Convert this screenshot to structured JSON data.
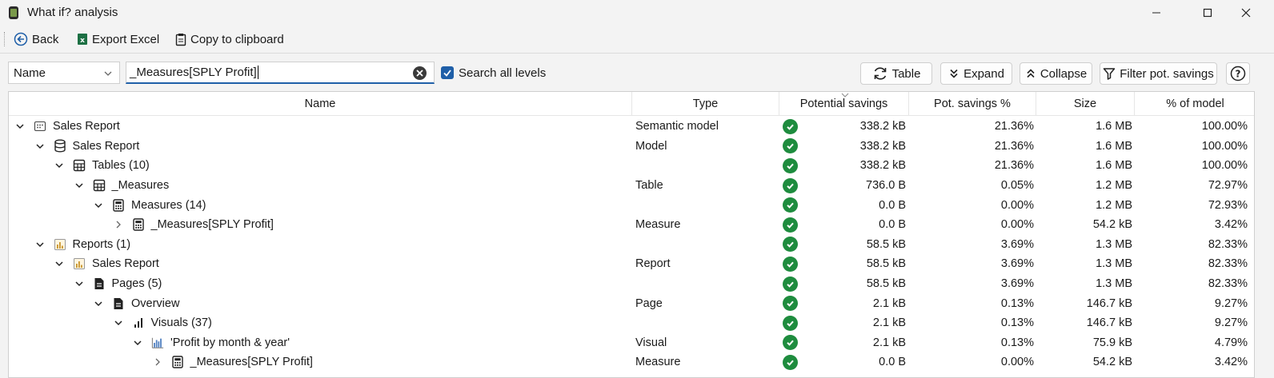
{
  "window": {
    "title": "What if? analysis"
  },
  "toolbar": {
    "back_label": "Back",
    "export_label": "Export Excel",
    "copy_label": "Copy to clipboard"
  },
  "filter": {
    "column_value": "Name",
    "search_value": "_Measures[SPLY Profit]",
    "search_all_levels_label": "Search all levels",
    "search_all_levels_checked": true
  },
  "buttons": {
    "table_label": "Table",
    "expand_label": "Expand",
    "collapse_label": "Collapse",
    "filter_label": "Filter pot. savings"
  },
  "columns": {
    "name": "Name",
    "type": "Type",
    "potential_savings": "Potential savings",
    "pot_savings_pct": "Pot. savings %",
    "size": "Size",
    "pct_of_model": "% of model"
  },
  "status_color": "#1e8c3e",
  "rows": [
    {
      "depth": 0,
      "expander": "open",
      "icon": "semantic-model-icon",
      "name": "Sales Report",
      "type": "Semantic model",
      "pot": "338.2 kB",
      "pct": "21.36%",
      "size": "1.6 MB",
      "model": "100.00%"
    },
    {
      "depth": 1,
      "expander": "open",
      "icon": "database-icon",
      "name": "Sales Report",
      "type": "Model",
      "pot": "338.2 kB",
      "pct": "21.36%",
      "size": "1.6 MB",
      "model": "100.00%"
    },
    {
      "depth": 2,
      "expander": "open",
      "icon": "table-grid-icon",
      "name": "Tables (10)",
      "type": "",
      "pot": "338.2 kB",
      "pct": "21.36%",
      "size": "1.6 MB",
      "model": "100.00%"
    },
    {
      "depth": 3,
      "expander": "open",
      "icon": "table-grid-icon",
      "name": "_Measures",
      "type": "Table",
      "pot": "736.0 B",
      "pct": "0.05%",
      "size": "1.2 MB",
      "model": "72.97%"
    },
    {
      "depth": 4,
      "expander": "open",
      "icon": "calculator-icon",
      "name": "Measures (14)",
      "type": "",
      "pot": "0.0 B",
      "pct": "0.00%",
      "size": "1.2 MB",
      "model": "72.93%"
    },
    {
      "depth": 5,
      "expander": "closed",
      "icon": "calculator-icon",
      "name": "_Measures[SPLY Profit]",
      "type": "Measure",
      "pot": "0.0 B",
      "pct": "0.00%",
      "size": "54.2 kB",
      "model": "3.42%"
    },
    {
      "depth": 1,
      "expander": "open",
      "icon": "report-icon",
      "name": "Reports (1)",
      "type": "",
      "pot": "58.5 kB",
      "pct": "3.69%",
      "size": "1.3 MB",
      "model": "82.33%"
    },
    {
      "depth": 2,
      "expander": "open",
      "icon": "report-icon",
      "name": "Sales Report",
      "type": "Report",
      "pot": "58.5 kB",
      "pct": "3.69%",
      "size": "1.3 MB",
      "model": "82.33%"
    },
    {
      "depth": 3,
      "expander": "open",
      "icon": "page-icon",
      "name": "Pages (5)",
      "type": "",
      "pot": "58.5 kB",
      "pct": "3.69%",
      "size": "1.3 MB",
      "model": "82.33%"
    },
    {
      "depth": 4,
      "expander": "open",
      "icon": "page-icon",
      "name": "Overview",
      "type": "Page",
      "pot": "2.1 kB",
      "pct": "0.13%",
      "size": "146.7 kB",
      "model": "9.27%"
    },
    {
      "depth": 5,
      "expander": "open",
      "icon": "bars-icon",
      "name": "Visuals (37)",
      "type": "",
      "pot": "2.1 kB",
      "pct": "0.13%",
      "size": "146.7 kB",
      "model": "9.27%"
    },
    {
      "depth": 6,
      "expander": "open",
      "icon": "column-chart-icon",
      "name": "'Profit by month & year'",
      "type": "Visual",
      "pot": "2.1 kB",
      "pct": "0.13%",
      "size": "75.9 kB",
      "model": "4.79%"
    },
    {
      "depth": 7,
      "expander": "closed",
      "icon": "calculator-icon",
      "name": "_Measures[SPLY Profit]",
      "type": "Measure",
      "pot": "0.0 B",
      "pct": "0.00%",
      "size": "54.2 kB",
      "model": "3.42%"
    }
  ]
}
